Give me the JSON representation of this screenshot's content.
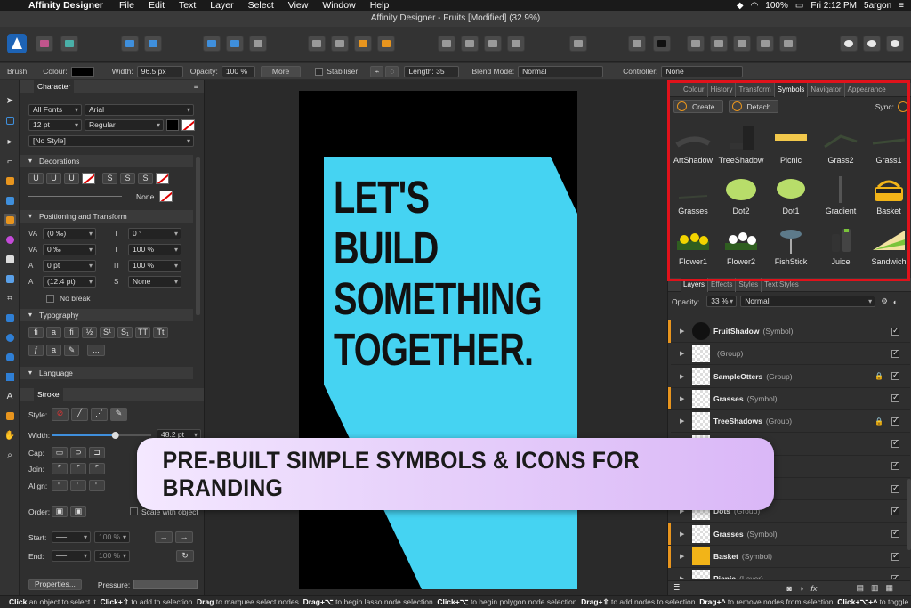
{
  "menubar": {
    "app": "Affinity Designer",
    "items": [
      "File",
      "Edit",
      "Text",
      "Layer",
      "Select",
      "View",
      "Window",
      "Help"
    ],
    "battery": "100%",
    "clock": "Fri 2:12 PM",
    "user": "5argon"
  },
  "window": {
    "title": "Affinity Designer - Fruits [Modified] (32.9%)"
  },
  "context": {
    "tool": "Brush",
    "colour_label": "Colour:",
    "width_label": "Width:",
    "width_value": "96.5 px",
    "opacity_label": "Opacity:",
    "opacity_value": "100 %",
    "more_label": "More",
    "stabiliser_label": "Stabiliser",
    "length_label": "Length: 35",
    "blend_label": "Blend Mode:",
    "blend_value": "Normal",
    "controller_label": "Controller:",
    "controller_value": "None"
  },
  "character": {
    "tab": "Character",
    "font_collection": "All Fonts",
    "font": "Arial",
    "size": "12 pt",
    "style": "Regular",
    "paragraph_style": "[No Style]",
    "decorations": "Decorations",
    "deco_buttons": [
      "U",
      "U",
      "U",
      "S",
      "S",
      "S"
    ],
    "none_label": "None",
    "positioning": "Positioning and Transform",
    "pos_fields": [
      "(0 ‰)",
      "0 °",
      "0 ‰",
      "100 %",
      "0 pt",
      "100 %",
      "(12.4 pt)",
      "None"
    ],
    "no_break": "No break",
    "typography": "Typography",
    "typo_buttons": [
      "fi",
      "a",
      "fi",
      "½",
      "S¹",
      "S₁",
      "TT",
      "Tt"
    ],
    "ellipsis": "...",
    "language": "Language"
  },
  "stroke": {
    "tab": "Stroke",
    "style_label": "Style:",
    "width_label": "Width:",
    "width_value": "48.2 pt",
    "width_fraction": 0.64,
    "cap_label": "Cap:",
    "join_label": "Join:",
    "align_label": "Align:",
    "order_label": "Order:",
    "scale_label": "Scale with object",
    "start_label": "Start:",
    "end_label": "End:",
    "start_pct": "100 %",
    "end_pct": "100 %",
    "properties_label": "Properties...",
    "pressure_label": "Pressure:"
  },
  "canvas": {
    "headline": [
      "LET'S",
      "BUILD",
      "SOMETHING",
      "TOGETHER."
    ],
    "cyan_color": "#45d3f2"
  },
  "symbols_panel": {
    "tabs": [
      "Colour",
      "History",
      "Transform",
      "Symbols",
      "Navigator",
      "Appearance"
    ],
    "active_tab": "Symbols",
    "create_label": "Create",
    "detach_label": "Detach",
    "sync_label": "Sync:",
    "items": [
      "ArtShadow",
      "TreeShadow",
      "Picnic",
      "Grass2",
      "Grass1",
      "Grasses",
      "Dot2",
      "Dot1",
      "Gradient",
      "Basket",
      "Flower1",
      "Flower2",
      "FishStick",
      "Juice",
      "Sandwich"
    ]
  },
  "layers_panel": {
    "tabs": [
      "Layers",
      "Effects",
      "Styles",
      "Text Styles"
    ],
    "opacity_label": "Opacity:",
    "opacity_value": "33 %",
    "blend_value": "Normal",
    "rows": [
      {
        "name": "FruitShadow",
        "type": "(Symbol)",
        "stripe": "#e8951e"
      },
      {
        "name": "",
        "type": "(Group)",
        "stripe": "#2f2f2f"
      },
      {
        "name": "SampleOtters",
        "type": "(Group)",
        "stripe": "#2f2f2f"
      },
      {
        "name": "Grasses",
        "type": "(Symbol)",
        "stripe": "#e8951e"
      },
      {
        "name": "TreeShadows",
        "type": "(Group)",
        "stripe": "#2f2f2f"
      },
      {
        "name": "",
        "type": "",
        "stripe": "#2f2f2f"
      },
      {
        "name": "",
        "type": "",
        "stripe": "#2f2f2f"
      },
      {
        "name": "",
        "type": "",
        "stripe": "#2f2f2f"
      },
      {
        "name": "Dots",
        "type": "(Group)",
        "stripe": "#2f2f2f"
      },
      {
        "name": "Grasses",
        "type": "(Symbol)",
        "stripe": "#e8951e"
      },
      {
        "name": "Basket",
        "type": "(Symbol)",
        "stripe": "#e8951e"
      },
      {
        "name": "Picnic",
        "type": "(Layer)",
        "stripe": "#2f2f2f"
      }
    ],
    "fx_label": "fx"
  },
  "statusbar": {
    "segments": [
      {
        "b": "Click",
        "t": " an object to select it. "
      },
      {
        "b": "Click+⇧",
        "t": " to add to selection. "
      },
      {
        "b": "Drag",
        "t": " to marquee select nodes. "
      },
      {
        "b": "Drag+⌥",
        "t": " to begin lasso node selection. "
      },
      {
        "b": "Click+⌥",
        "t": " to begin polygon node selection. "
      },
      {
        "b": "Drag+⇧",
        "t": " to add nodes to selection. "
      },
      {
        "b": "Drag+^",
        "t": " to remove nodes from selection. "
      },
      {
        "b": "Click+⌥+^",
        "t": " to toggle node"
      }
    ]
  },
  "banner": {
    "text": "PRE-BUILT SIMPLE SYMBOLS & ICONS FOR BRANDING"
  }
}
